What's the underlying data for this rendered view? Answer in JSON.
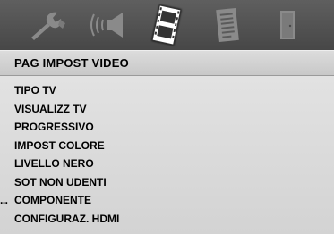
{
  "tabs": [
    {
      "icon": "wrench-icon",
      "active": false
    },
    {
      "icon": "speaker-icon",
      "active": false
    },
    {
      "icon": "film-icon",
      "active": true
    },
    {
      "icon": "document-icon",
      "active": false
    },
    {
      "icon": "door-icon",
      "active": false
    }
  ],
  "header": {
    "title": "PAG IMPOST VIDEO"
  },
  "menu": {
    "items": [
      {
        "label": "TIPO TV"
      },
      {
        "label": "VISUALIZZ TV"
      },
      {
        "label": "PROGRESSIVO"
      },
      {
        "label": "IMPOST COLORE"
      },
      {
        "label": "LIVELLO NERO"
      },
      {
        "label": "SOT NON UDENTI"
      },
      {
        "label": "COMPONENTE",
        "marker": "..."
      },
      {
        "label": "CONFIGURAZ. HDMI"
      }
    ]
  },
  "colors": {
    "bar": "#525252",
    "icon_inactive": "#8a8a8a",
    "icon_active": "#ffffff",
    "panel": "#dadada"
  }
}
